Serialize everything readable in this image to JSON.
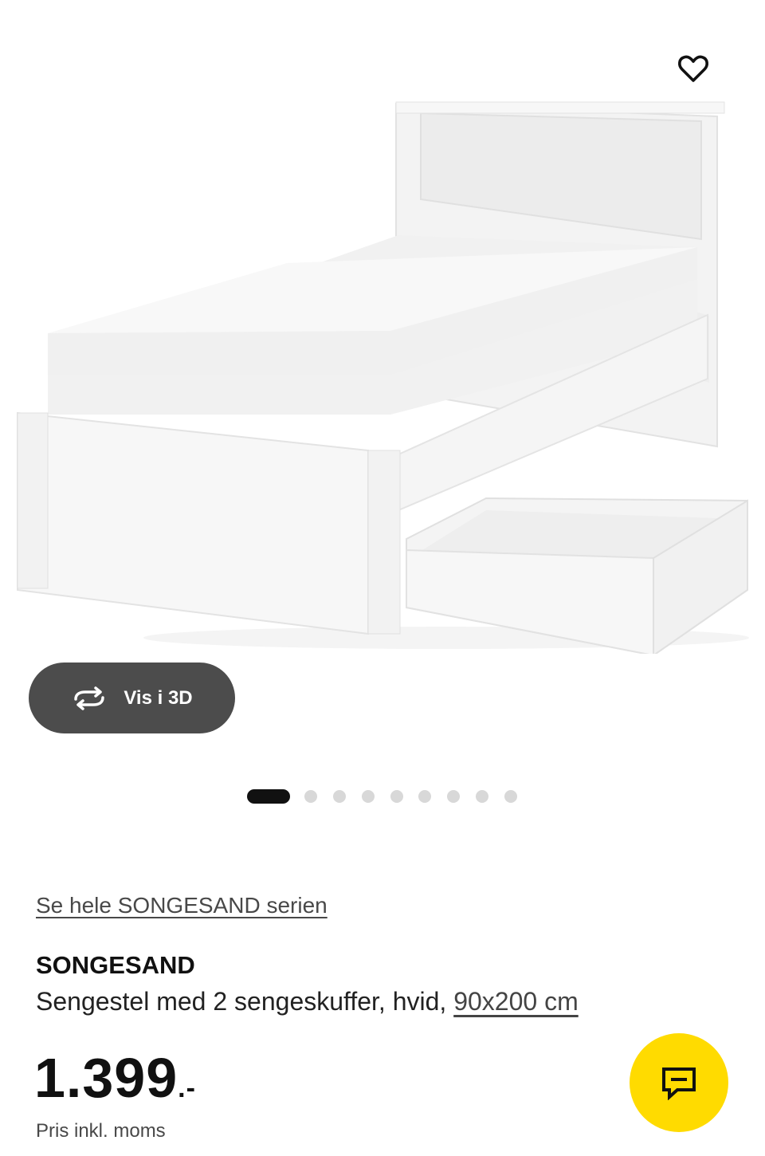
{
  "gallery": {
    "image_alt": "SONGESAND bed frame with 2 storage boxes, white",
    "favorite_icon": "heart-outline-icon",
    "view_3d": {
      "label": "Vis i 3D",
      "icon": "rotate-arrows-icon"
    },
    "carousel": {
      "total": 9,
      "active": 1
    }
  },
  "product": {
    "series_link": "Se hele SONGESAND serien",
    "name": "SONGESAND",
    "description": "Sengestel med 2 sengeskuffer, hvid,",
    "size": "90x200 cm",
    "price": "1.399",
    "price_suffix": ".-",
    "price_note": "Pris inkl. moms"
  },
  "chat": {
    "icon": "chat-bubble-icon"
  },
  "colors": {
    "chat_button": "#ffdb00",
    "view3d_button": "#4c4c4c",
    "dot_active": "#111111",
    "dot_inactive": "#d8d8d8"
  }
}
